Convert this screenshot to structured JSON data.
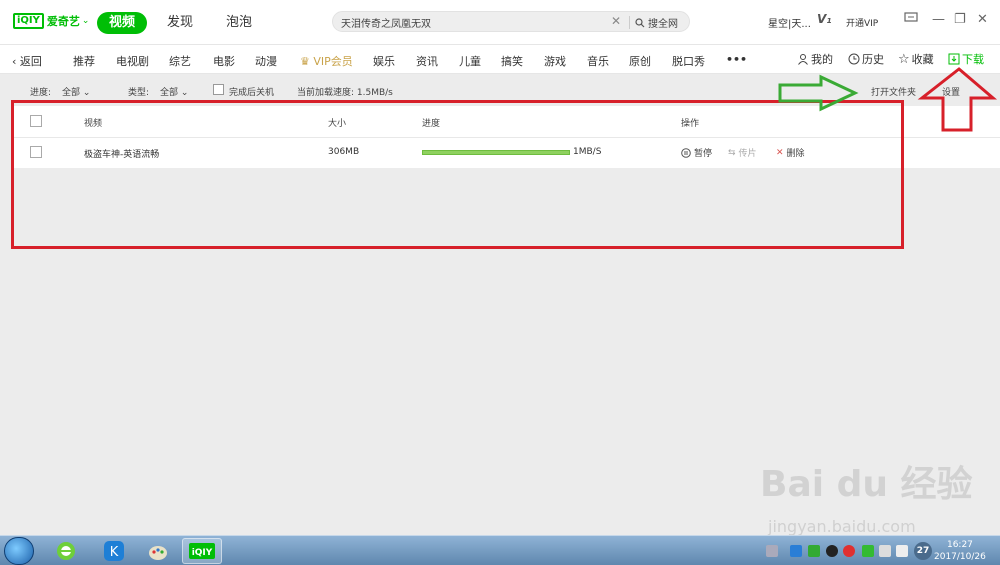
{
  "app": {
    "logo_mark": "iQIY",
    "logo_text": "爱奇艺",
    "tabs": [
      "视频",
      "发现",
      "泡泡"
    ],
    "search_text": "天泪传奇之凤凰无双",
    "search_button": "搜全网",
    "user_name": "星空|天...",
    "vip_level": "V₁",
    "open_vip": "开通VIP"
  },
  "nav": {
    "back": "返回",
    "items": [
      "推荐",
      "电视剧",
      "综艺",
      "电影",
      "动漫",
      "VIP会员",
      "娱乐",
      "资讯",
      "儿童",
      "搞笑",
      "游戏",
      "音乐",
      "原创",
      "脱口秀"
    ],
    "more": "•••",
    "right": [
      "我的",
      "历史",
      "收藏",
      "下载"
    ]
  },
  "filter": {
    "progress_label": "进度:",
    "progress_value": "全部",
    "type_label": "类型:",
    "type_value": "全部",
    "shutdown_label": "完成后关机",
    "speed_text": "当前加载速度: 1.5MB/s",
    "open_folder": "打开文件夹",
    "settings": "设置"
  },
  "table": {
    "headers": [
      "视频",
      "大小",
      "进度",
      "操作"
    ],
    "rows": [
      {
        "name": "极盗车神-英语流畅",
        "size": "306MB",
        "progress": 1.0,
        "speed": "1MB/S",
        "pause": "暂停",
        "share": "传片",
        "delete": "删除"
      }
    ]
  },
  "watermark": {
    "text": "Bai du 经验",
    "url": "jingyan.baidu.com"
  },
  "taskbar": {
    "time": "16:27",
    "date": "2017/10/26",
    "tray_badge": "27"
  },
  "colors": {
    "brand": "#00be06",
    "vip": "#c9a34a",
    "annotation_red": "#d7202a",
    "annotation_green": "#3aaa35"
  }
}
